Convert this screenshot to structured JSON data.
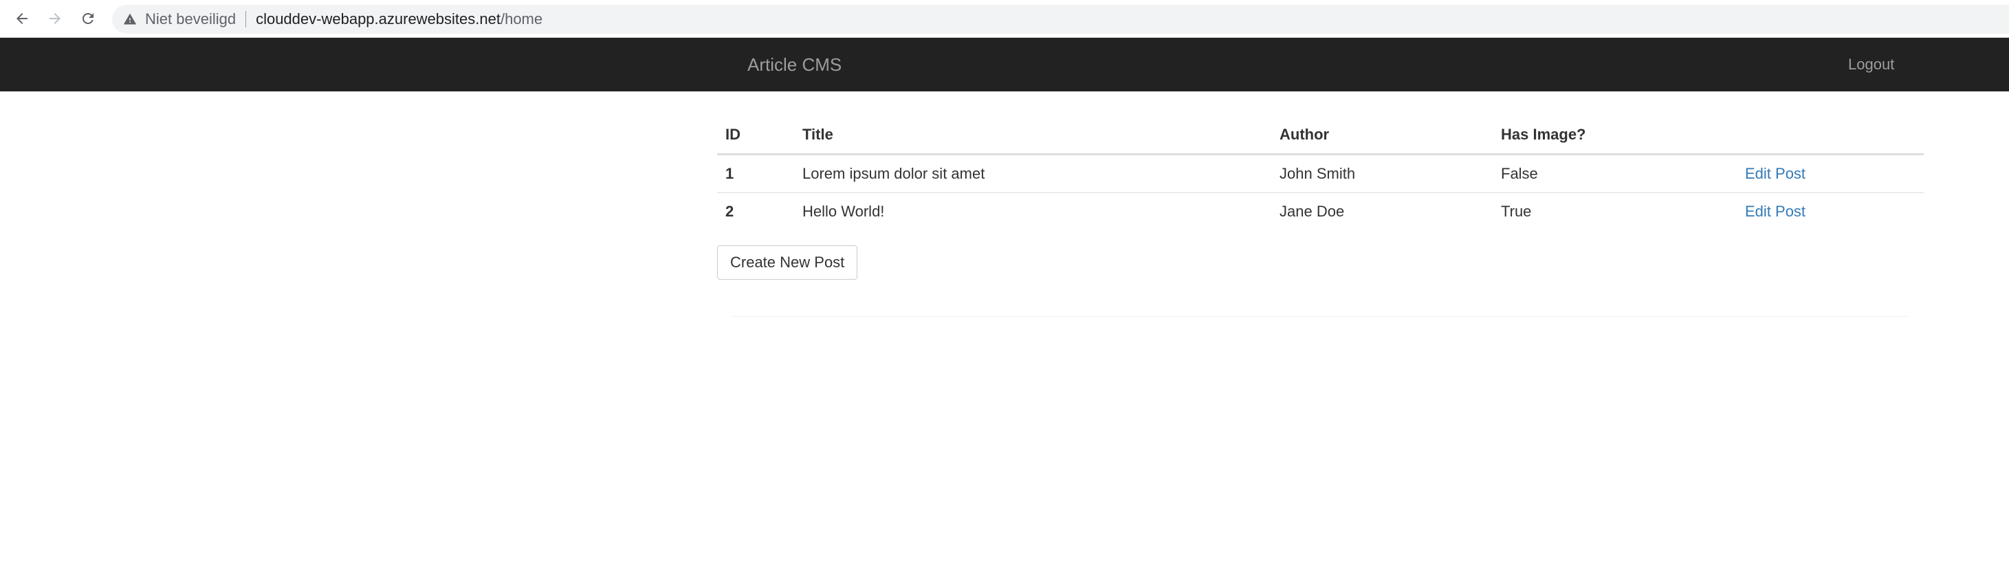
{
  "browser": {
    "security_status": "Niet beveiligd",
    "url_host": "clouddev-webapp.azurewebsites.net",
    "url_path": "/home"
  },
  "navbar": {
    "brand": "Article CMS",
    "logout": "Logout"
  },
  "table": {
    "columns": [
      "ID",
      "Title",
      "Author",
      "Has Image?",
      ""
    ],
    "rows": [
      {
        "id": "1",
        "title": "Lorem ipsum dolor sit amet",
        "author": "John Smith",
        "has_image": "False",
        "action": "Edit Post"
      },
      {
        "id": "2",
        "title": "Hello World!",
        "author": "Jane Doe",
        "has_image": "True",
        "action": "Edit Post"
      }
    ]
  },
  "create_button": "Create New Post",
  "colors": {
    "navbar_bg": "#222222",
    "navbar_text": "#9d9d9d",
    "link": "#337ab7"
  }
}
